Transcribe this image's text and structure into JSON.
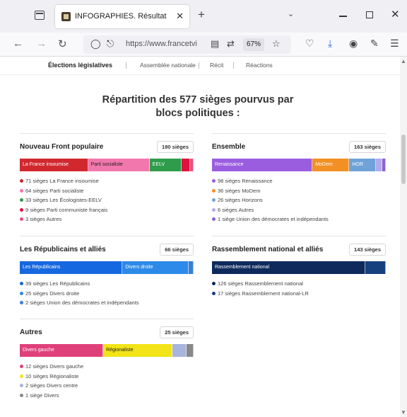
{
  "browser": {
    "tab_title": "INFOGRAPHIES. Résultats des é",
    "tab_close": "✕",
    "new_tab": "+",
    "url": "https://www.francetvi",
    "zoom": "67%"
  },
  "subnav": [
    "Élections législatives",
    "Assemblée nationale",
    "Récit",
    "Réactions"
  ],
  "title_line1": "Répartition des 577 sièges pourvus par",
  "title_line2": "blocs politiques :",
  "blocks": [
    {
      "name": "Nouveau Front populaire",
      "seats_label": "180 sièges",
      "segments": [
        {
          "label": "La France insoumise",
          "value": 71,
          "color": "#d1282e"
        },
        {
          "label": "Parti socialiste",
          "value": 64,
          "color": "#f277ad"
        },
        {
          "label": "EELV",
          "value": 33,
          "color": "#2e9c4a"
        },
        {
          "label": "",
          "value": 9,
          "color": "#e0113f"
        },
        {
          "label": "",
          "value": 3,
          "color": "#e8517d"
        }
      ],
      "legend": [
        {
          "text": "71 sièges La France insoumise",
          "color": "#d1282e"
        },
        {
          "text": "64 sièges Parti socialiste",
          "color": "#f277ad"
        },
        {
          "text": "33 sièges Les Écologistes-EELV",
          "color": "#2e9c4a"
        },
        {
          "text": "9 sièges Parti communiste français",
          "color": "#e0113f"
        },
        {
          "text": "3 sièges Autres",
          "color": "#e8517d"
        }
      ]
    },
    {
      "name": "Ensemble",
      "seats_label": "163 sièges",
      "segments": [
        {
          "label": "Renaissance",
          "value": 98,
          "color": "#9b5de0"
        },
        {
          "label": "MoDem",
          "value": 36,
          "color": "#f39024"
        },
        {
          "label": "HOR",
          "value": 26,
          "color": "#6fa3d8"
        },
        {
          "label": "",
          "value": 6,
          "color": "#b3a9ee"
        },
        {
          "label": "",
          "value": 1,
          "color": "#8e5fd6"
        }
      ],
      "legend": [
        {
          "text": "98 sièges Renaissance",
          "color": "#9b5de0"
        },
        {
          "text": "36 sièges MoDem",
          "color": "#f39024"
        },
        {
          "text": "26 sièges Horizons",
          "color": "#6fa3d8"
        },
        {
          "text": "6 sièges Autres",
          "color": "#b3a9ee"
        },
        {
          "text": "1 siège Union des démocrates et indépendants",
          "color": "#8e5fd6"
        }
      ]
    },
    {
      "name": "Les Républicains et alliés",
      "seats_label": "66 sièges",
      "segments": [
        {
          "label": "Les Républicains",
          "value": 39,
          "color": "#1668e0"
        },
        {
          "label": "Divers droite",
          "value": 25,
          "color": "#2d8ae8"
        },
        {
          "label": "",
          "value": 2,
          "color": "#3b7fd4"
        }
      ],
      "legend": [
        {
          "text": "39 sièges Les Républicains",
          "color": "#1668e0"
        },
        {
          "text": "25 sièges Divers droite",
          "color": "#2d8ae8"
        },
        {
          "text": "2 sièges Union des démocrates et indépendants",
          "color": "#3b7fd4"
        }
      ]
    },
    {
      "name": "Rassemblement national et alliés",
      "seats_label": "143 sièges",
      "segments": [
        {
          "label": "Rassemblement national",
          "value": 126,
          "color": "#0e2a5c"
        },
        {
          "label": "",
          "value": 17,
          "color": "#17407e"
        }
      ],
      "legend": [
        {
          "text": "126 sièges Rassemblement national",
          "color": "#0e2a5c"
        },
        {
          "text": "17 sièges Rassemblement national-LR",
          "color": "#17407e"
        }
      ]
    },
    {
      "name": "Autres",
      "seats_label": "25 sièges",
      "segments": [
        {
          "label": "Divers gauche",
          "value": 12,
          "color": "#e0407a"
        },
        {
          "label": "Régionaliste",
          "value": 10,
          "color": "#f2e418"
        },
        {
          "label": "",
          "value": 2,
          "color": "#a9b4dd"
        },
        {
          "label": "",
          "value": 1,
          "color": "#888888"
        }
      ],
      "legend": [
        {
          "text": "12 sièges Divers gauche",
          "color": "#e0407a"
        },
        {
          "text": "10 sièges Régionaliste",
          "color": "#f2e418"
        },
        {
          "text": "2 sièges Divers centre",
          "color": "#a9b4dd"
        },
        {
          "text": "1 siège Divers",
          "color": "#888888"
        }
      ]
    }
  ]
}
